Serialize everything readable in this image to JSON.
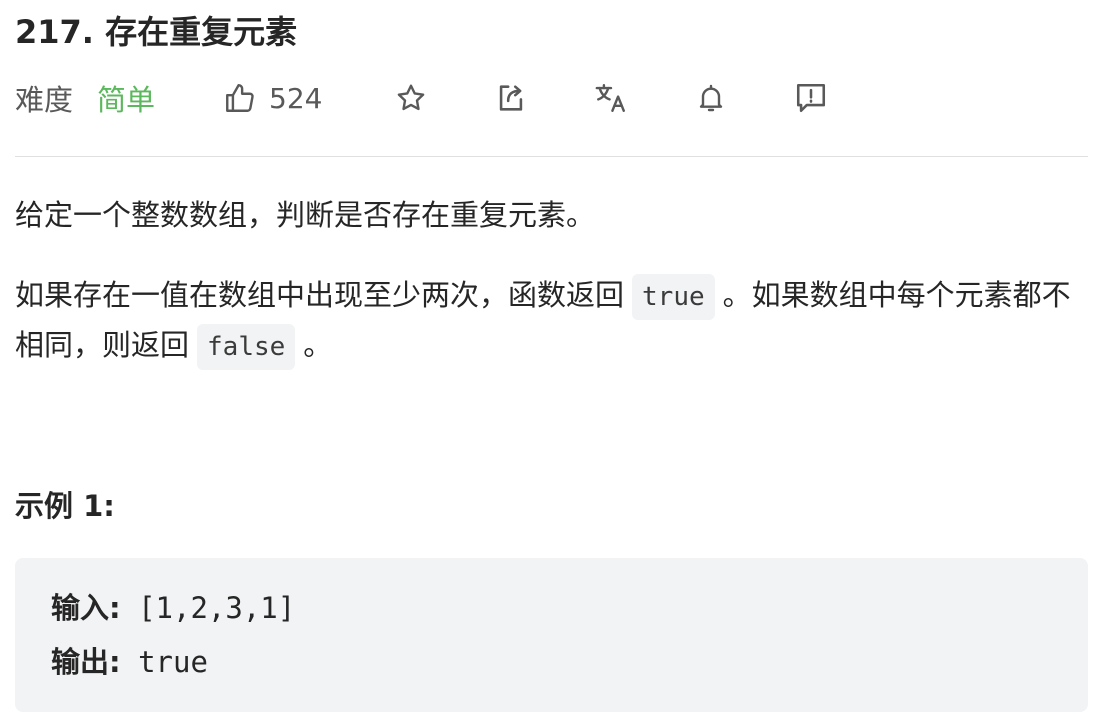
{
  "problem": {
    "title": "217. 存在重复元素"
  },
  "meta": {
    "difficulty_label": "难度",
    "difficulty_value": "简单",
    "likes": "524",
    "icons": {
      "like": "thumbs-up-icon",
      "favorite": "star-icon",
      "share": "share-icon",
      "translate": "translate-icon",
      "notify": "bell-icon",
      "feedback": "feedback-icon"
    },
    "colors": {
      "difficulty_easy": "#5cb85c",
      "icon": "#595959"
    }
  },
  "description": {
    "para1": "给定一个整数数组，判断是否存在重复元素。",
    "para2_part1": "如果存在一值在数组中出现至少两次，函数返回",
    "code_true": "true",
    "para2_part2": "。如果数组中每个元素都不相同，则返回",
    "code_false": "false",
    "para2_part3": "。"
  },
  "example": {
    "heading": "示例 1:",
    "input_label": "输入:",
    "input_value": "[1,2,3,1]",
    "output_label": "输出:",
    "output_value": "true"
  }
}
